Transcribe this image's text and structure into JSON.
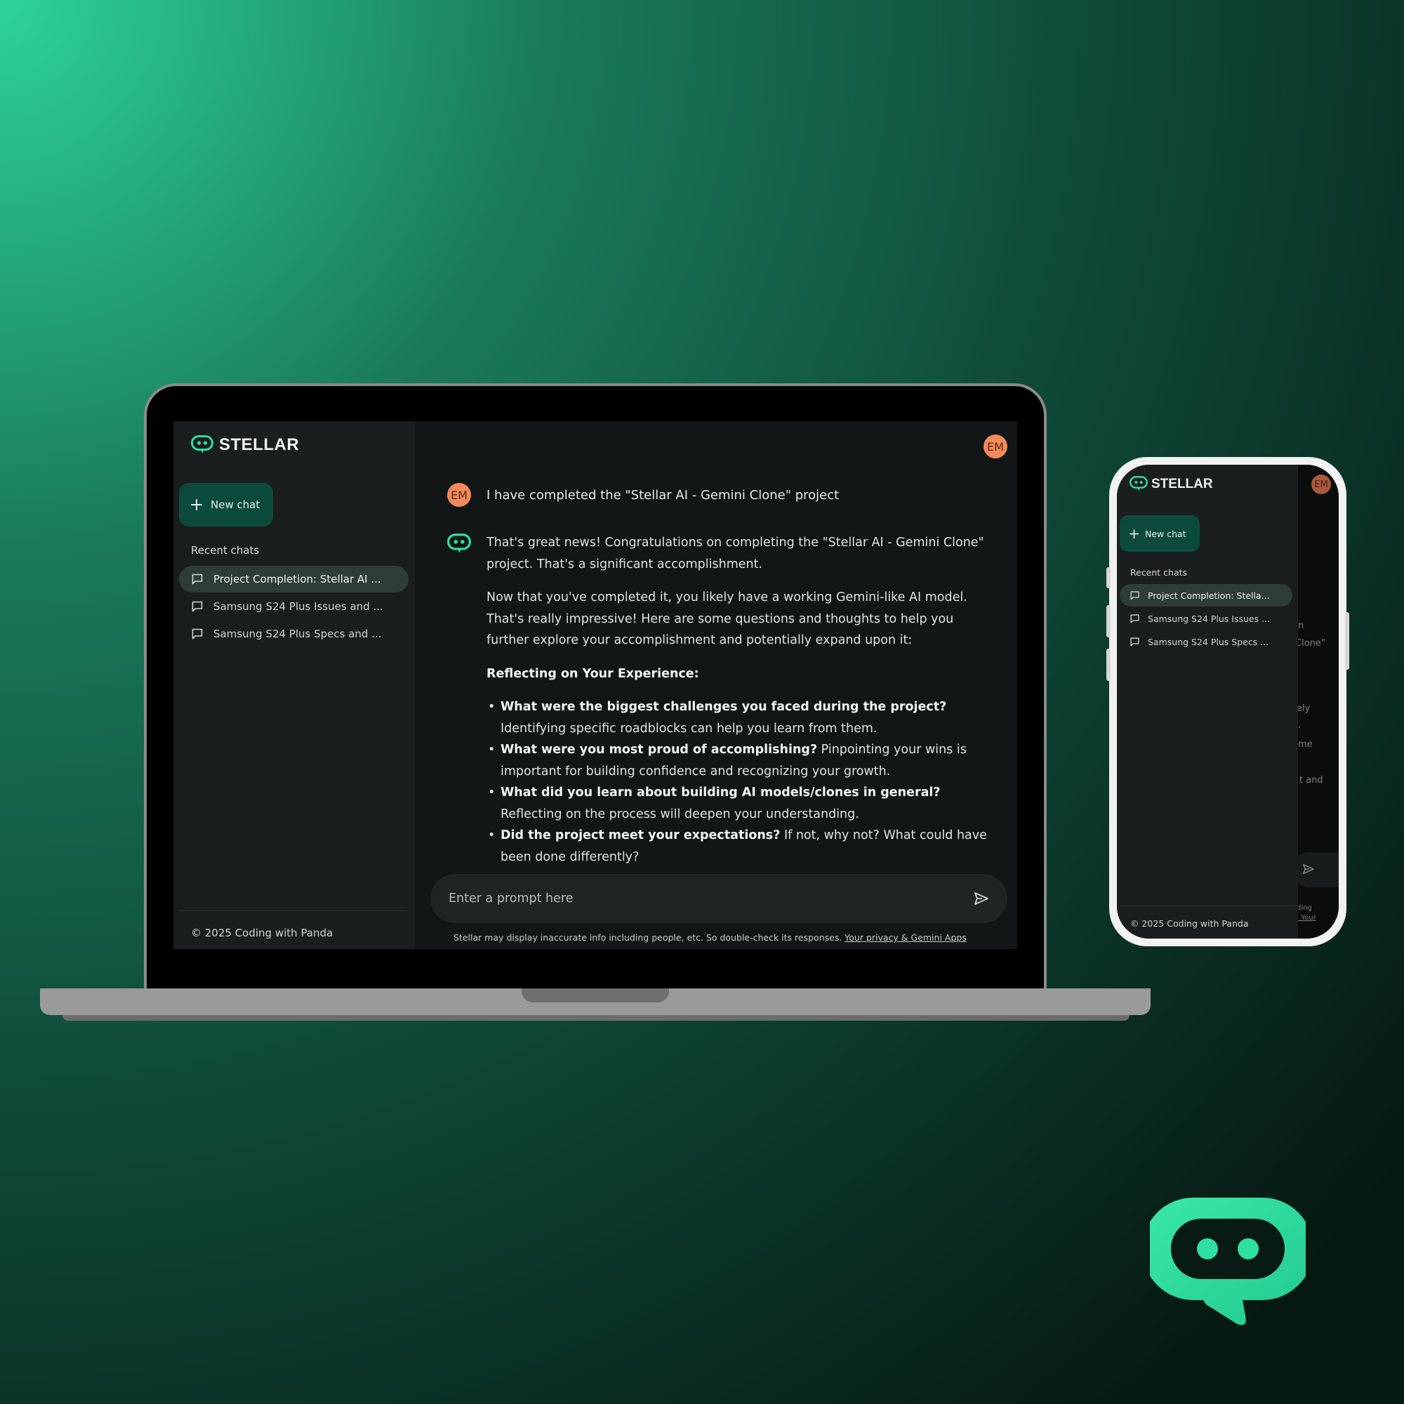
{
  "brand": {
    "name": "STELLAR",
    "accent": "#2ee0a0"
  },
  "sidebar": {
    "new_chat_label": "New chat",
    "recent_label": "Recent chats",
    "chats": [
      {
        "label": "Project Completion: Stellar AI ...",
        "active": true
      },
      {
        "label": "Samsung S24 Plus Issues and ...",
        "active": false
      },
      {
        "label": "Samsung S24 Plus Specs and ...",
        "active": false
      }
    ],
    "footer": "© 2025 Coding with Panda"
  },
  "user": {
    "initials": "EM"
  },
  "conversation": {
    "user_message": "I have completed the \"Stellar AI - Gemini Clone\" project",
    "bot_paragraph_1": "That's great news! Congratulations on completing the \"Stellar AI - Gemini Clone\" project. That's a significant accomplishment.",
    "bot_paragraph_2": "Now that you've completed it, you likely have a working Gemini-like AI model. That's really impressive! Here are some questions and thoughts to help you further explore your accomplishment and potentially expand upon it:",
    "section_heading": "Reflecting on Your Experience:",
    "bullets": [
      {
        "bold": "What were the biggest challenges you faced during the project?",
        "text": " Identifying specific roadblocks can help you learn from them."
      },
      {
        "bold": "What were you most proud of accomplishing?",
        "text": " Pinpointing your wins is important for building confidence and recognizing your growth."
      },
      {
        "bold": "What did you learn about building AI models/clones in general?",
        "text": " Reflecting on the process will deepen your understanding."
      },
      {
        "bold": "Did the project meet your expectations?",
        "text": " If not, why not? What could have been done differently?"
      }
    ]
  },
  "prompt": {
    "placeholder": "Enter a prompt here"
  },
  "disclaimer": {
    "text": "Stellar may display inaccurate info including people, etc. So double-check its responses. ",
    "link": "Your privacy & Gemini Apps"
  },
  "phone": {
    "new_chat_label": "New chat",
    "recent_label": "Recent chats",
    "chats": [
      {
        "label": "Project Completion: Stella...",
        "active": true
      },
      {
        "label": "Samsung S24 Plus Issues ...",
        "active": false
      },
      {
        "label": "Samsung S24 Plus Specs ...",
        "active": false
      }
    ],
    "footer": "© 2025 Coding with Panda",
    "peek_texts": [
      "n",
      "Clone\"",
      "ely",
      ".",
      "me",
      "t and",
      "ding",
      ". Your"
    ]
  },
  "colors": {
    "screen_bg": "#121616",
    "sidebar_bg": "#1a1e1e",
    "new_chat_bg": "#0c4b3c",
    "active_chat_bg": "#2f3d3a",
    "avatar_bg": "#f28a5c"
  },
  "icons": {
    "logo": "chat-bubble-robot-icon",
    "new_chat": "plus-icon",
    "chat_item": "message-square-icon",
    "send": "send-icon"
  }
}
